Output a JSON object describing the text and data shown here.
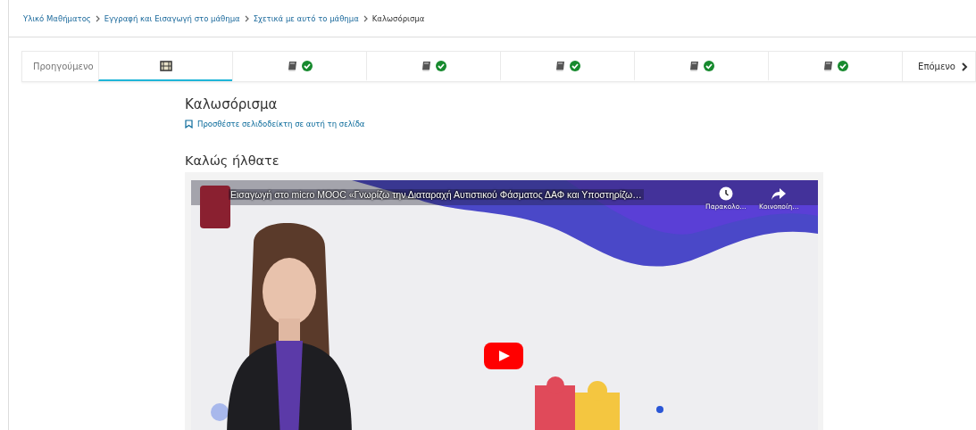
{
  "breadcrumb": [
    {
      "label": "Υλικό Μαθήματος",
      "link": true
    },
    {
      "label": "Εγγραφή και Εισαγωγή στο μάθημα",
      "link": true
    },
    {
      "label": "Σχετικά με αυτό το μάθημα",
      "link": true
    },
    {
      "label": "Καλωσόρισμα",
      "link": false
    }
  ],
  "unit_nav": {
    "previous": "Προηγούμενο",
    "next": "Επόμενο",
    "units": [
      {
        "kind": "video",
        "completed": false,
        "selected": true
      },
      {
        "kind": "book",
        "completed": true,
        "selected": false
      },
      {
        "kind": "book",
        "completed": true,
        "selected": false
      },
      {
        "kind": "book",
        "completed": true,
        "selected": false
      },
      {
        "kind": "book",
        "completed": true,
        "selected": false
      },
      {
        "kind": "book",
        "completed": true,
        "selected": false
      }
    ]
  },
  "page_title": "Καλωσόρισμα",
  "bookmark_link": "Προσθέστε σελιδοδείκτη σε αυτή τη σελίδα",
  "section_title": "Καλώς ήλθατε",
  "video": {
    "kind": "picture",
    "title": "Εισαγωγή στο micro MOOC «Γνωρίζω την Διαταραχή Αυτιστικού Φάσματος ΔΑΦ και Υποστηρίζω…",
    "watch_later": "Παρακολο…",
    "share": "Κοινοποίη…"
  }
}
